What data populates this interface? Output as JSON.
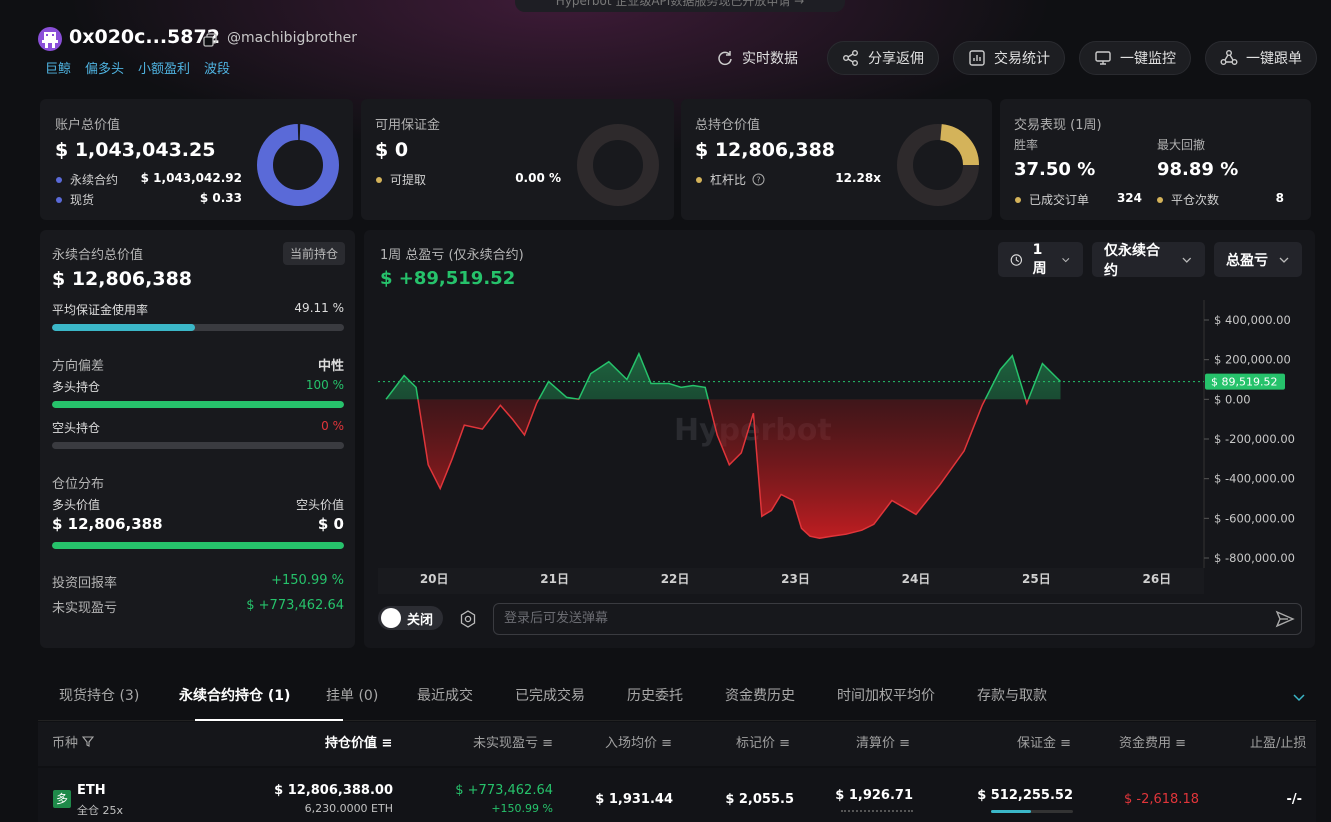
{
  "banner": "Hyperbot 企业级API数据服务现已开放申请 →",
  "header": {
    "address": "0x020c...5872",
    "handle": "@machibigbrother",
    "tags": [
      "巨鲸",
      "偏多头",
      "小额盈利",
      "波段"
    ]
  },
  "actions": [
    "实时数据",
    "分享返佣",
    "交易统计",
    "一键监控",
    "一键跟单"
  ],
  "cards": {
    "account": {
      "label": "账户总价值",
      "value": "$ 1,043,043.25",
      "rows": [
        {
          "label": "永续合约",
          "value": "$ 1,043,042.92"
        },
        {
          "label": "现货",
          "value": "$ 0.33"
        }
      ]
    },
    "margin": {
      "label": "可用保证金",
      "value": "$ 0",
      "rows": [
        {
          "label": "可提取",
          "value": "0.00 %"
        }
      ]
    },
    "position": {
      "label": "总持仓价值",
      "value": "$ 12,806,388",
      "rows": [
        {
          "label": "杠杆比",
          "value": "12.28x"
        }
      ]
    },
    "performance": {
      "label": "交易表现 (1周)",
      "win_label": "胜率",
      "win_value": "37.50 %",
      "dd_label": "最大回撤",
      "dd_value": "98.89 %",
      "orders_label": "已成交订单",
      "orders_value": "324",
      "close_label": "平仓次数",
      "close_value": "8"
    },
    "colors": {
      "perp": "#5a6ad8",
      "spot": "#5a6ad8",
      "gold": "#d4b35a",
      "green": "#26c26b",
      "red": "#e0353a",
      "cyan": "#3bb7c8"
    }
  },
  "left": {
    "perp_label": "永续合约总价值",
    "current_badge": "当前持仓",
    "perp_value": "$ 12,806,388",
    "margin_use_label": "平均保证金使用率",
    "margin_use_value": "49.11 %",
    "margin_use_pct": 49.11,
    "bias_label": "方向偏差",
    "bias_value": "中性",
    "long_label": "多头持仓",
    "long_value": "100 %",
    "long_pct": 100,
    "short_label": "空头持仓",
    "short_value": "0 %",
    "short_pct": 0,
    "dist_label": "仓位分布",
    "long_val_label": "多头价值",
    "short_val_label": "空头价值",
    "long_val": "$ 12,806,388",
    "short_val": "$ 0",
    "roi_label": "投资回报率",
    "roi_value": "+150.99 %",
    "upnl_label": "未实现盈亏",
    "upnl_value": "$ +773,462.64"
  },
  "chart_panel": {
    "title": "1周 总盈亏 (仅永续合约)",
    "value": "$ +89,519.52",
    "dropdowns": [
      "1周",
      "仅永续合约",
      "总盈亏"
    ],
    "toggle_label": "关闭",
    "danmaku_placeholder": "登录后可发送弹幕",
    "watermark": "Hyperbot"
  },
  "chart_data": {
    "type": "area",
    "title": "1周 总盈亏 (仅永续合约)",
    "x_ticks": [
      "20日",
      "21日",
      "22日",
      "23日",
      "24日",
      "25日",
      "26日"
    ],
    "y_ticks": [
      "$ 400,000.00",
      "$ 200,000.00",
      "$ 0.00",
      "$ -200,000.00",
      "$ -400,000.00",
      "$ -600,000.00",
      "$ -800,000.00"
    ],
    "ylim": [
      -800000,
      400000
    ],
    "current_label": "$ 89,519.52",
    "current_value": 89519.52,
    "x": [
      19.6,
      19.75,
      19.85,
      19.95,
      20.05,
      20.15,
      20.25,
      20.4,
      20.55,
      20.65,
      20.75,
      20.85,
      20.95,
      21.1,
      21.2,
      21.3,
      21.45,
      21.6,
      21.7,
      21.8,
      21.95,
      22.05,
      22.15,
      22.25,
      22.35,
      22.45,
      22.55,
      22.65,
      22.72,
      22.8,
      22.88,
      22.98,
      23.05,
      23.12,
      23.2,
      23.3,
      23.42,
      23.55,
      23.65,
      23.8,
      24.0,
      24.2,
      24.4,
      24.55,
      24.7,
      24.8,
      24.92,
      25.05,
      25.2,
      25.35,
      25.5,
      25.6,
      25.75,
      25.85,
      25.95,
      26.05,
      26.15,
      26.25,
      26.35
    ],
    "y": [
      0,
      120000,
      60000,
      -330000,
      -450000,
      -300000,
      -130000,
      -150000,
      -30000,
      -100000,
      -180000,
      -20000,
      90000,
      10000,
      0,
      130000,
      190000,
      100000,
      230000,
      80000,
      80000,
      60000,
      70000,
      60000,
      -180000,
      -330000,
      -270000,
      -70000,
      -590000,
      -560000,
      -480000,
      -510000,
      -650000,
      -690000,
      -700000,
      -690000,
      -680000,
      -660000,
      -630000,
      -510000,
      -580000,
      -430000,
      -260000,
      -30000,
      150000,
      220000,
      -20000,
      180000,
      90000
    ],
    "y_note": "unused"
  },
  "tabs": [
    "现货持仓 (3)",
    "永续合约持仓 (1)",
    "挂单 (0)",
    "最近成交",
    "已完成交易",
    "历史委托",
    "资金费历史",
    "时间加权平均价",
    "存款与取款"
  ],
  "table": {
    "headers": [
      "币种",
      "持仓价值",
      "未实现盈亏",
      "入场均价",
      "标记价",
      "清算价",
      "保证金",
      "资金费用",
      "止盈/止损"
    ],
    "row": {
      "badge": "多",
      "coin": "ETH",
      "mode": "全仓 25x",
      "value": "$ 12,806,388.00",
      "size": "6,230.0000 ETH",
      "upnl": "$ +773,462.64",
      "upnl_pct": "+150.99 %",
      "entry": "$ 1,931.44",
      "mark": "$ 2,055.5",
      "liq": "$ 1,926.71",
      "margin": "$ 512,255.52",
      "funding": "$ -2,618.18",
      "tpsl": "-/-"
    }
  }
}
